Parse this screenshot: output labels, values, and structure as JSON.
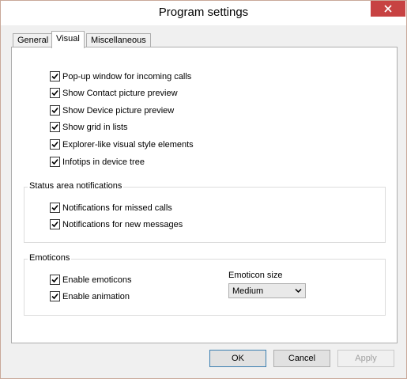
{
  "window": {
    "title": "Program settings"
  },
  "tabs": [
    {
      "label": "General",
      "active": false
    },
    {
      "label": "Visual",
      "active": true
    },
    {
      "label": "Miscellaneous",
      "active": false
    }
  ],
  "visual_options": [
    {
      "label": "Pop-up window for incoming calls",
      "checked": true
    },
    {
      "label": "Show Contact picture preview",
      "checked": true
    },
    {
      "label": "Show Device picture preview",
      "checked": true
    },
    {
      "label": "Show grid in lists",
      "checked": true
    },
    {
      "label": "Explorer-like visual style elements",
      "checked": true
    },
    {
      "label": "Infotips in device tree",
      "checked": true
    }
  ],
  "status_area": {
    "title": "Status area notifications",
    "options": [
      {
        "label": "Notifications for missed calls",
        "checked": true
      },
      {
        "label": "Notifications for new messages",
        "checked": true
      }
    ]
  },
  "emoticons": {
    "title": "Emoticons",
    "options": [
      {
        "label": "Enable emoticons",
        "checked": true
      },
      {
        "label": "Enable animation",
        "checked": true
      }
    ],
    "size_label": "Emoticon size",
    "size_value": "Medium"
  },
  "buttons": {
    "ok": "OK",
    "cancel": "Cancel",
    "apply": "Apply"
  }
}
